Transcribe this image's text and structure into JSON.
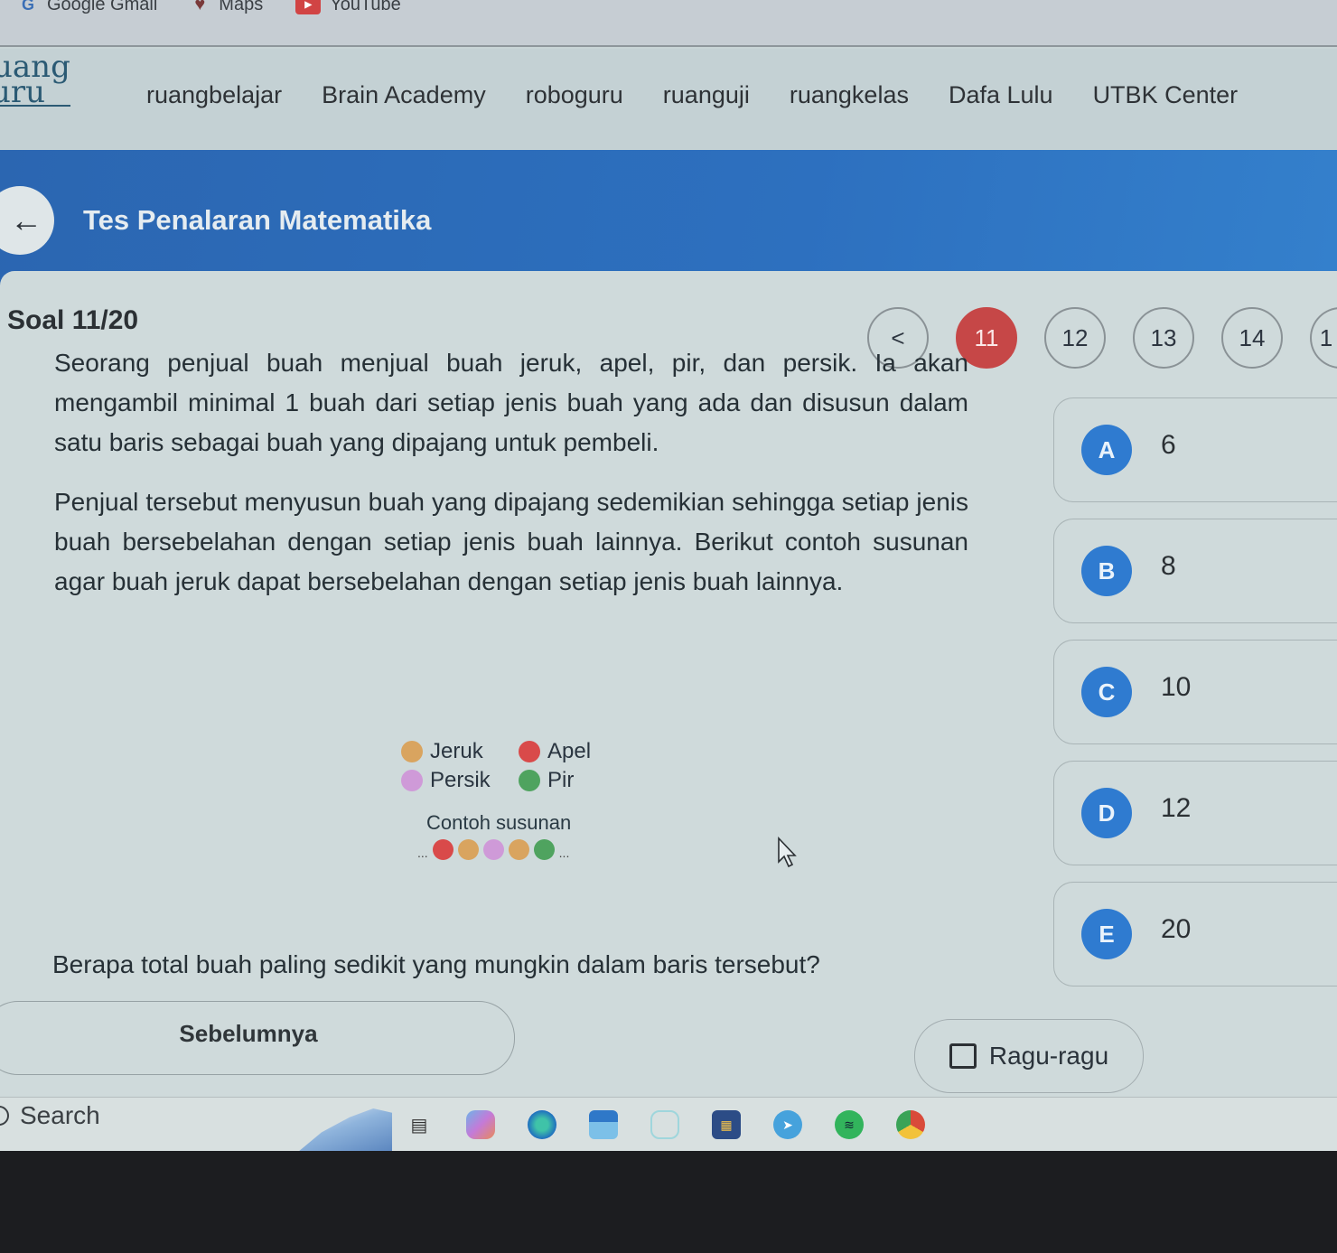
{
  "bookmarks": [
    {
      "icon": "google-icon",
      "label": "Google Gmail"
    },
    {
      "icon": "maps-icon",
      "label": "Maps"
    },
    {
      "icon": "youtube-icon",
      "label": "YouTube"
    }
  ],
  "site": {
    "logo_line1": "uang",
    "logo_line2": "uru",
    "nav": [
      "ruangbelajar",
      "Brain Academy",
      "roboguru",
      "ruanguji",
      "ruangkelas",
      "Dafa Lulu",
      "UTBK Center"
    ]
  },
  "header": {
    "back_icon": "←",
    "title": "Tes Penalaran Matematika"
  },
  "quiz": {
    "progress": "Soal 11/20",
    "prev_icon": "<",
    "question_numbers": [
      "11",
      "12",
      "13",
      "14"
    ],
    "current": "11",
    "partial_next": "1",
    "paragraphs": [
      "Seorang penjual buah menjual buah jeruk, apel, pir, dan persik. Ia akan mengambil minimal 1 buah dari setiap jenis buah yang ada dan disusun dalam satu baris sebagai buah yang dipajang untuk pembeli.",
      "Penjual tersebut menyusun buah yang dipajang sedemikian sehingga setiap jenis buah bersebelahan dengan setiap jenis buah lainnya. Berikut contoh susunan agar buah jeruk dapat bersebelahan dengan setiap jenis buah lainnya."
    ],
    "figure": {
      "legend": [
        {
          "label": "Jeruk",
          "color": "#d9a45f"
        },
        {
          "label": "Apel",
          "color": "#d94a4a"
        },
        {
          "label": "Persik",
          "color": "#cf9ad8"
        },
        {
          "label": "Pir",
          "color": "#4fa35f"
        }
      ],
      "caption": "Contoh susunan",
      "ellipsis": "...",
      "sample_sequence": [
        "#d94a4a",
        "#d9a45f",
        "#cf9ad8",
        "#d9a45f",
        "#4fa35f"
      ]
    },
    "final_question": "Berapa total buah paling sedikit yang mungkin dalam baris tersebut?",
    "options": [
      {
        "letter": "A",
        "value": "6"
      },
      {
        "letter": "B",
        "value": "8"
      },
      {
        "letter": "C",
        "value": "10"
      },
      {
        "letter": "D",
        "value": "12"
      },
      {
        "letter": "E",
        "value": "20"
      }
    ],
    "prev_button": "Sebelumnya",
    "doubt_label": "Ragu-ragu",
    "doubt_checked": false
  },
  "taskbar": {
    "search_label": "Search",
    "icons": [
      "task-view-icon",
      "copilot-icon",
      "edge-icon",
      "mail-icon",
      "pet-app-icon",
      "store-icon",
      "telegram-icon",
      "spotify-icon",
      "chrome-icon"
    ]
  },
  "colors": {
    "brand_blue": "#2d70bf",
    "active_question": "#c64747",
    "option_badge": "#2f7bd0"
  }
}
